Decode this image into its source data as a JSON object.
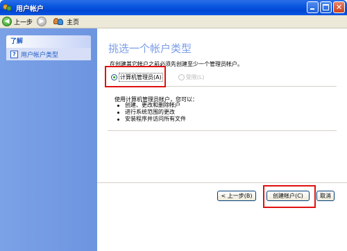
{
  "window": {
    "title": "用户帐户"
  },
  "nav": {
    "back_label": "上一步",
    "home_label": "主页"
  },
  "sidebar": {
    "header": "了解",
    "items": [
      {
        "label": "用户帐户类型",
        "icon": "help-icon"
      }
    ]
  },
  "main": {
    "title": "挑选一个帐户类型",
    "instruction": "在创建其它帐户之前必须先创建至少一个管理员帐户。",
    "options": [
      {
        "label": "计算机管理员(A)",
        "selected": true,
        "enabled": true
      },
      {
        "label": "受限(L)",
        "selected": false,
        "enabled": false
      }
    ],
    "description": {
      "intro": "使用计算机管理员帐户，您可以：",
      "bullets": [
        "创建、更改和删除帐户",
        "进行系统范围的更改",
        "安装程序并访问所有文件"
      ]
    }
  },
  "buttons": {
    "back": "< 上一步(B)",
    "create": "创建帐户(C)",
    "cancel": "取消"
  },
  "colors": {
    "title_bar": "#0a58e0",
    "sidebar": "#7ba2e7",
    "page_title": "#7a9ce8",
    "highlight": "#e01010"
  }
}
